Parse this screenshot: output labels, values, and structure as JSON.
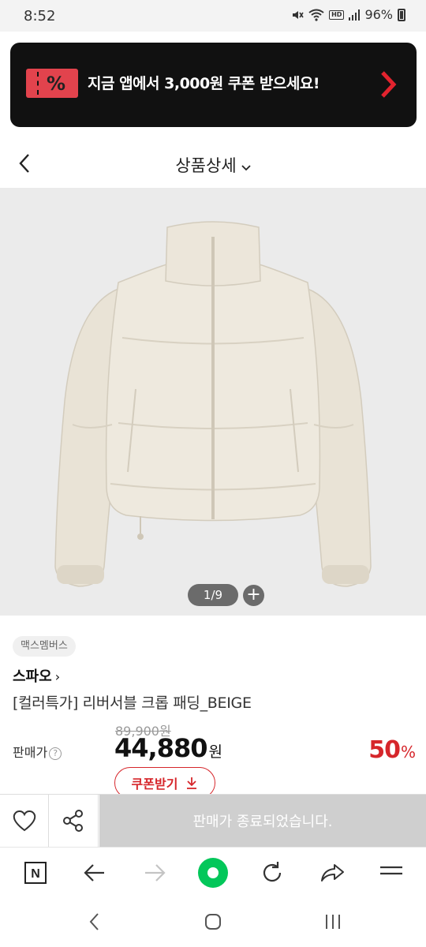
{
  "status_bar": {
    "time": "8:52",
    "hd_label": "HD",
    "battery": "96%",
    "icons": [
      "mute-icon",
      "wifi-icon",
      "hd-voice-icon",
      "signal-icon",
      "battery-icon"
    ]
  },
  "promo": {
    "ticket_symbol": "%",
    "text": "지금 앱에서 3,000원 쿠폰 받으세요!",
    "icons": [
      "coupon-ticket-icon",
      "chevron-right-icon"
    ],
    "accent_color": "#e2434d"
  },
  "header": {
    "title": "상품상세",
    "icons": [
      "back-icon",
      "chevron-down-icon"
    ]
  },
  "product_image": {
    "counter": "1/9",
    "plus": "+",
    "background": "#ebebeb"
  },
  "product": {
    "badge": "맥스멤버스",
    "store": "스파오",
    "store_chevron": "›",
    "name": "[컬러특가] 리버서블 크롭 패딩_BEIGE",
    "original_price": "89,900원",
    "price_label": "판매가",
    "help_symbol": "?",
    "sale_price": "44,880",
    "currency": "원",
    "discount": "50",
    "discount_unit": "%",
    "coupon_button": "쿠폰받기",
    "discount_color": "#d6262b"
  },
  "purchase_bar": {
    "soldout_label": "판매가 종료되었습니다.",
    "icons": [
      "heart-icon",
      "share-icon"
    ]
  },
  "browser_toolbar": {
    "n_label": "N",
    "icons": [
      "naver-home-icon",
      "back-arrow-icon",
      "forward-arrow-icon",
      "green-dot-icon",
      "refresh-icon",
      "share-arrow-icon",
      "menu-icon"
    ],
    "green_color": "#03c75a"
  },
  "android_nav": {
    "icons": [
      "nav-back-icon",
      "nav-home-icon",
      "nav-recents-icon"
    ]
  }
}
